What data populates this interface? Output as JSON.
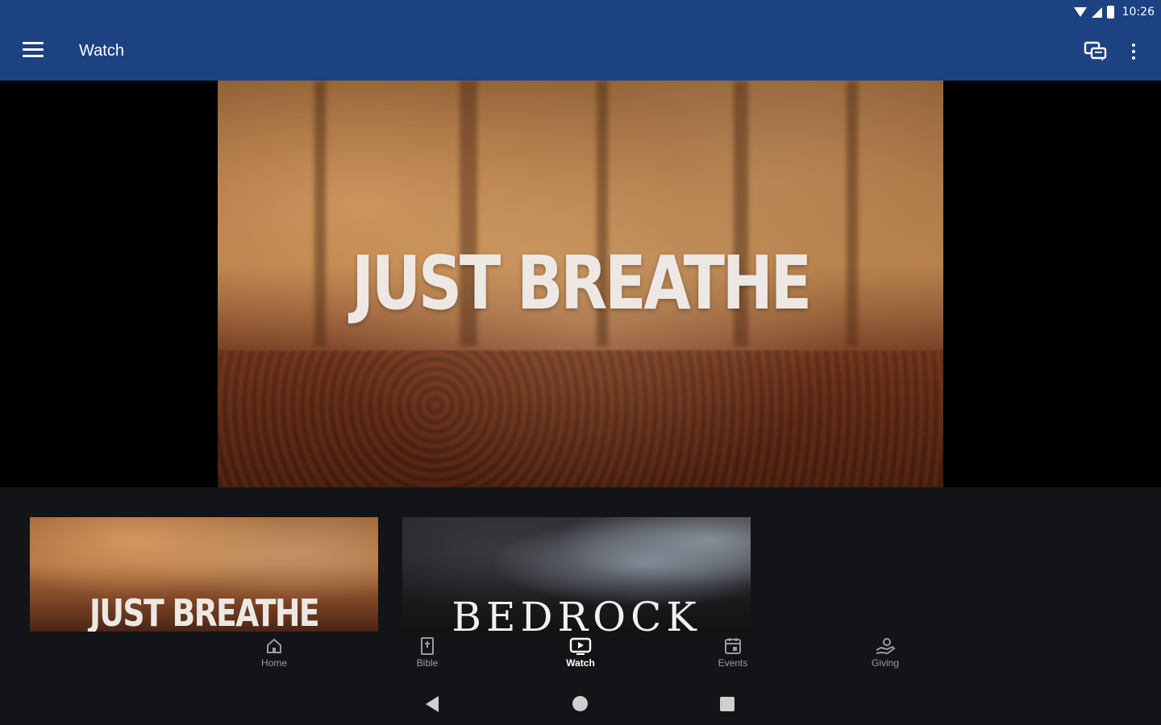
{
  "status_bar": {
    "time": "10:26"
  },
  "app_bar": {
    "title": "Watch"
  },
  "hero": {
    "title": "JUST BREATHE"
  },
  "series": [
    {
      "title": "JUST BREATHE"
    },
    {
      "title": "BEDROCK"
    }
  ],
  "bottom_nav": {
    "active": "Watch",
    "items": [
      {
        "label": "Home",
        "icon": "home-icon"
      },
      {
        "label": "Bible",
        "icon": "bible-icon"
      },
      {
        "label": "Watch",
        "icon": "tv-icon"
      },
      {
        "label": "Events",
        "icon": "calendar-icon"
      },
      {
        "label": "Giving",
        "icon": "giving-hand-icon"
      }
    ]
  },
  "colors": {
    "app_bar": "#1c4282",
    "background": "#121417",
    "nav_inactive": "#9a9ca0",
    "nav_active": "#ffffff"
  }
}
